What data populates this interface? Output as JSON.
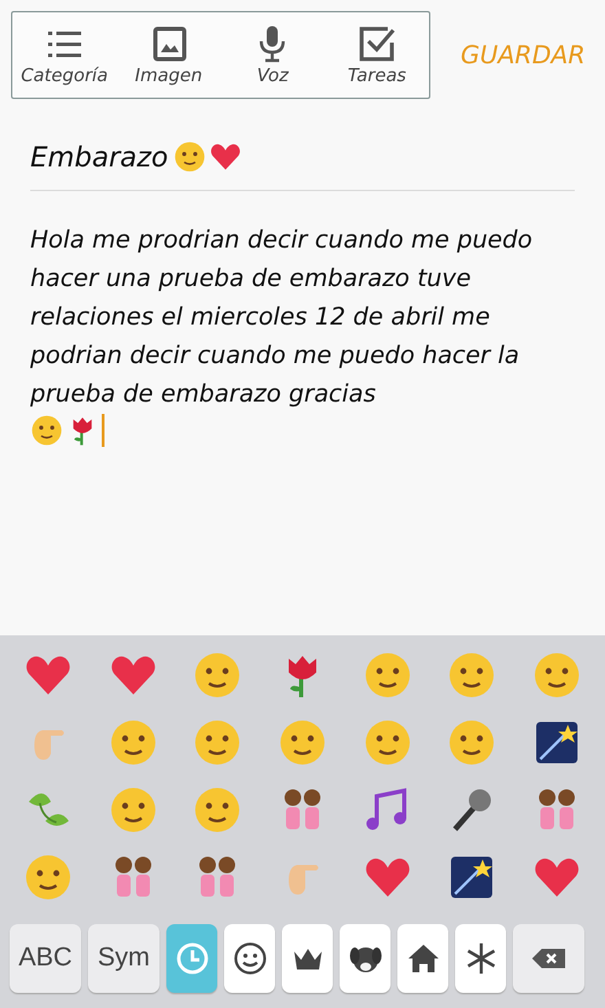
{
  "toolbar": {
    "items": [
      {
        "label": "Categoría",
        "kind": "list"
      },
      {
        "label": "Imagen",
        "kind": "image"
      },
      {
        "label": "Voz",
        "kind": "mic"
      },
      {
        "label": "Tareas",
        "kind": "check"
      }
    ],
    "save": "GUARDAR"
  },
  "note": {
    "title": "Embarazo",
    "title_emojis": [
      {
        "kind": "face"
      },
      {
        "kind": "heart"
      }
    ],
    "body": "Hola me prodrian decir cuando me puedo hacer una prueba de embarazo tuve relaciones el miercoles 12 de abril me podrian decir cuando me puedo hacer la prueba de embarazo gracias",
    "body_emojis": [
      {
        "kind": "face"
      },
      {
        "kind": "rose"
      }
    ],
    "cursor": true
  },
  "keyboard": {
    "emojis": [
      {
        "kind": "heart"
      },
      {
        "kind": "heart"
      },
      {
        "kind": "face"
      },
      {
        "kind": "rose"
      },
      {
        "kind": "face"
      },
      {
        "kind": "face"
      },
      {
        "kind": "face"
      },
      {
        "kind": "hand"
      },
      {
        "kind": "face"
      },
      {
        "kind": "face"
      },
      {
        "kind": "face"
      },
      {
        "kind": "face"
      },
      {
        "kind": "face"
      },
      {
        "kind": "star"
      },
      {
        "kind": "leaf"
      },
      {
        "kind": "face"
      },
      {
        "kind": "face"
      },
      {
        "kind": "people"
      },
      {
        "kind": "note"
      },
      {
        "kind": "mic"
      },
      {
        "kind": "people"
      },
      {
        "kind": "face"
      },
      {
        "kind": "people"
      },
      {
        "kind": "people"
      },
      {
        "kind": "hand"
      },
      {
        "kind": "heart"
      },
      {
        "kind": "star"
      },
      {
        "kind": "heart"
      }
    ],
    "keys": [
      {
        "kind": "text",
        "label": "ABC"
      },
      {
        "kind": "text",
        "label": "Sym"
      },
      {
        "kind": "clock",
        "selected": true
      },
      {
        "kind": "smiley",
        "selected": false
      },
      {
        "kind": "crown",
        "selected": false
      },
      {
        "kind": "dog",
        "selected": false
      },
      {
        "kind": "home",
        "selected": false
      },
      {
        "kind": "asterisk",
        "selected": false
      },
      {
        "kind": "delete"
      }
    ]
  }
}
